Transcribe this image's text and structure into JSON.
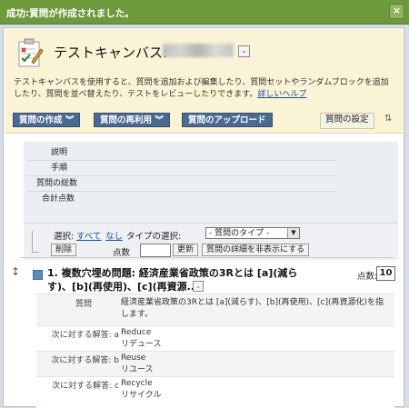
{
  "success": {
    "message": "成功:質問が作成されました。",
    "close_glyph": "×"
  },
  "canvas": {
    "title": "テストキャンバス:",
    "description": "テストキャンバスを使用すると、質問を追加および編集したり、質問セットやランダムブロックを追加したり、質問を並べ替えたり、テストをレビューしたりできます。",
    "help_link": "詳しいヘルプ"
  },
  "actions": {
    "create": "質問の作成",
    "reuse": "質問の再利用",
    "upload": "質問のアップロード",
    "settings": "質問の設定"
  },
  "info": {
    "rows": [
      {
        "label": "説明"
      },
      {
        "label": "手順"
      },
      {
        "label": "質問の総数"
      },
      {
        "label": "合計点数"
      }
    ]
  },
  "toolbar": {
    "select_label": "選択:",
    "select_all": "すべて",
    "select_none": "なし",
    "type_label": "タイプの選択:",
    "type_value": "- 質問のタイプ -",
    "delete_btn": "削除",
    "points_label": "点数",
    "update_btn": "更新",
    "hide_details_btn": "質問の詳細を非表示にする"
  },
  "question": {
    "title": "1. 複数穴埋め問題: 経済産業省政策の3Rとは [a](減らす)、[b](再使用)、[c](再資源...",
    "points_label": "点数:",
    "points_value": "10",
    "question_label": "質問",
    "question_text": "経済産業省政策の3Rとは [a](減らす)、[b](再使用)、[c](再資源化)を指します。",
    "answers": [
      {
        "label": "次に対する解答: a",
        "en": "Reduce",
        "ja": "リデュース"
      },
      {
        "label": "次に対する解答: b",
        "en": "Reuse",
        "ja": "リユース"
      },
      {
        "label": "次に対する解答: c",
        "en": "Recycle",
        "ja": "リサイクル"
      }
    ]
  },
  "colors": {
    "success_bar": "#6f9a3c",
    "action_button": "#4a6a92",
    "header_panel": "#fbf3d5",
    "link": "#1a4fa0"
  }
}
